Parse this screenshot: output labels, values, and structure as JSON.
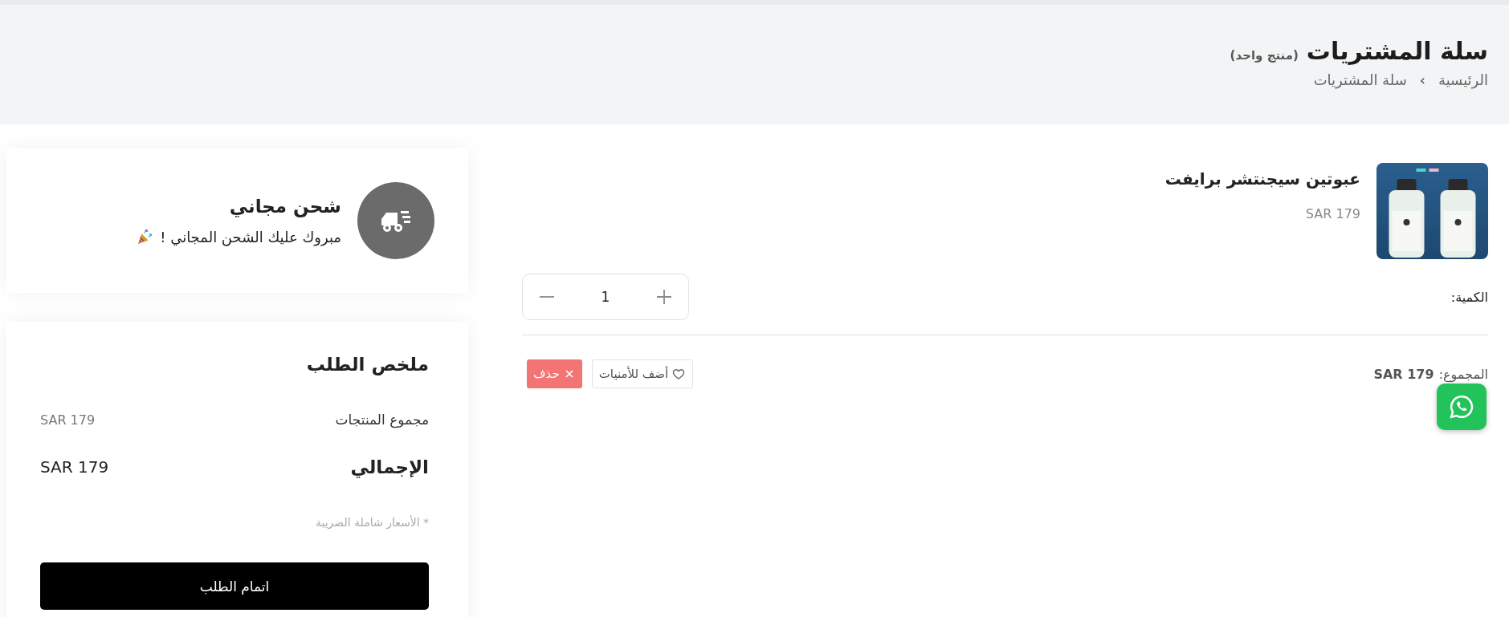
{
  "header": {
    "title": "سلة المشتريات",
    "count": "(منتج واحد)",
    "breadcrumb": [
      {
        "label": "الرئيسية"
      },
      {
        "label": "سلة المشتريات"
      }
    ],
    "separator": "›"
  },
  "cart_items": [
    {
      "name": "عبوتين سيجنتشر برايفت",
      "price": "SAR 179",
      "quantity_label": "الكمية:",
      "quantity": "1",
      "total_label": "المجموع:",
      "total": "SAR 179",
      "wishlist_label": "أضف للأمنيات",
      "delete_label": "حذف"
    }
  ],
  "shipping_card": {
    "title": "شحن مجاني",
    "message": "مبروك عليك الشحن المجاني !"
  },
  "summary": {
    "title": "ملخص الطلب",
    "rows": [
      {
        "label": "مجموع المنتجات",
        "value": "SAR 179",
        "kind": "subtotal"
      },
      {
        "label": "الإجمالي",
        "value": "SAR 179",
        "kind": "total"
      }
    ],
    "note": "* الأسعار شاملة الضريبة",
    "checkout_label": "اتمام الطلب"
  }
}
